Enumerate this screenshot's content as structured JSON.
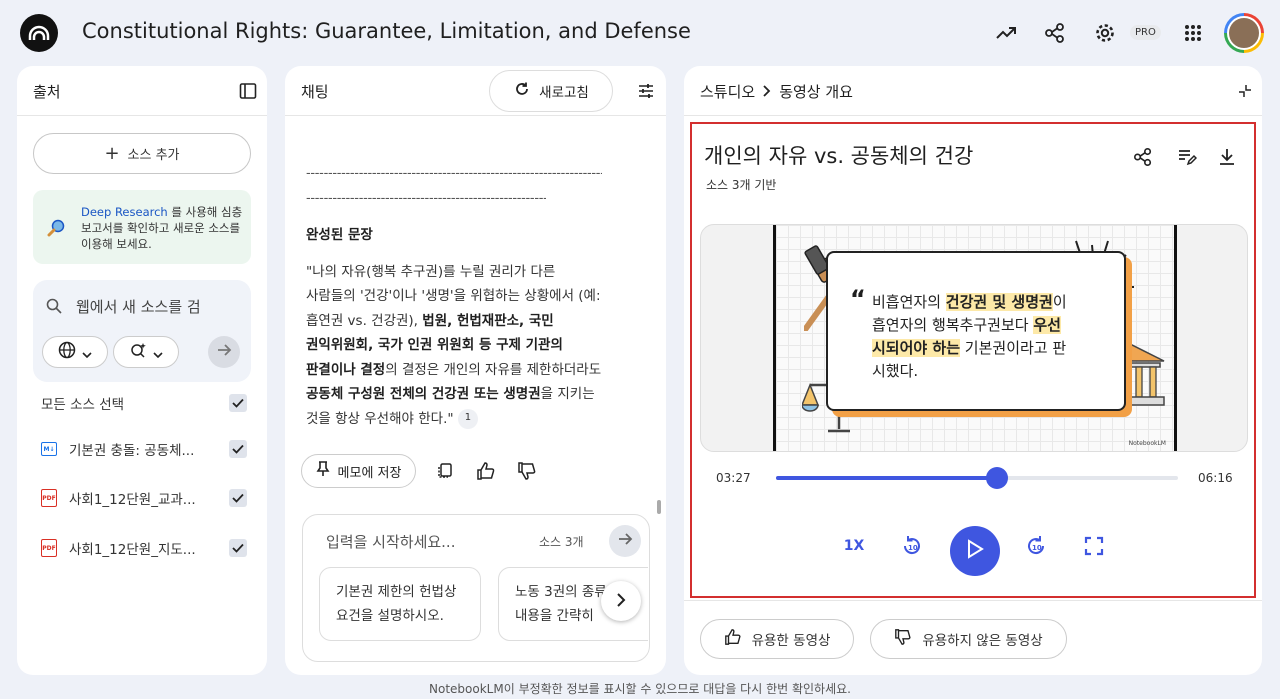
{
  "header": {
    "title": "Constitutional Rights: Guarantee, Limitation, and Defense",
    "pro_badge": "PRO"
  },
  "sources_panel": {
    "title": "출처",
    "add_source": "소스 추가",
    "deep_research": {
      "link": "Deep Research",
      "text": " 를 사용해 심층 보고서를 확인하고 새로운 소스를 이용해 보세요."
    },
    "search_placeholder": "웹에서 새 소스를 검",
    "select_all": "모든 소스 선택",
    "sources": [
      {
        "label": "기본권 충돌: 공동체...",
        "type": "md"
      },
      {
        "label": "사회1_12단원_교과...",
        "type": "pdf"
      },
      {
        "label": "사회1_12단원_지도...",
        "type": "pdf"
      }
    ]
  },
  "chat_panel": {
    "title": "채팅",
    "refresh": "새로고침",
    "divider_line": "-----------------------------------------------------------------------------------------",
    "heading": "완성된 문장",
    "quote": {
      "p1": "\"나의 자유(행복 추구권)를 누릴 권리가 다른 사람들의 '건강'이나 '생명'을 위협하는 상황에서 (예: 흡연권 vs. 건강권), ",
      "b1": "법원, 헌법재판소, 국민 권익위원회, 국가 인권 위원회 등 구제 기관의 판결이나 결정",
      "p2": "의 결정은 개인의 자유를 제한하더라도 ",
      "b2": "공동체 구성원 전체의 건강권 또는 생명권",
      "p3": "을 지키는 것을 항상 우선해야 한다.\" "
    },
    "citation": "1",
    "save_memo": "메모에 저장",
    "input_placeholder": "입력을 시작하세요...",
    "source_count": "소스 3개",
    "suggestions": [
      "기본권 제한의 헌법상 요건을 설명하시오.",
      "노동 3권의 종류와 내용을 간략히"
    ]
  },
  "studio_panel": {
    "breadcrumb": [
      "스튜디오",
      "동영상 개요"
    ],
    "video": {
      "title": "개인의 자유 vs. 공동체의 건강",
      "subtitle": "소스 3개 기반",
      "slide_text": {
        "t1": "비흡연자의 ",
        "h1": "건강권 및 생명권",
        "t2": "이 흡연자의 행복추구권보다 ",
        "h2": "우선시되어야 하는",
        "t3": " 기본권이라고 판시했다."
      },
      "watermark": "NotebookLM",
      "current_time": "03:27",
      "total_time": "06:16",
      "progress": 0.55,
      "speed": "1X"
    },
    "helpful": "유용한 동영상",
    "not_helpful": "유용하지 않은 동영상"
  },
  "footer": {
    "disclaimer": "NotebookLM이 부정확한 정보를 표시할 수 있으므로 대답을 다시 한번 확인하세요."
  }
}
